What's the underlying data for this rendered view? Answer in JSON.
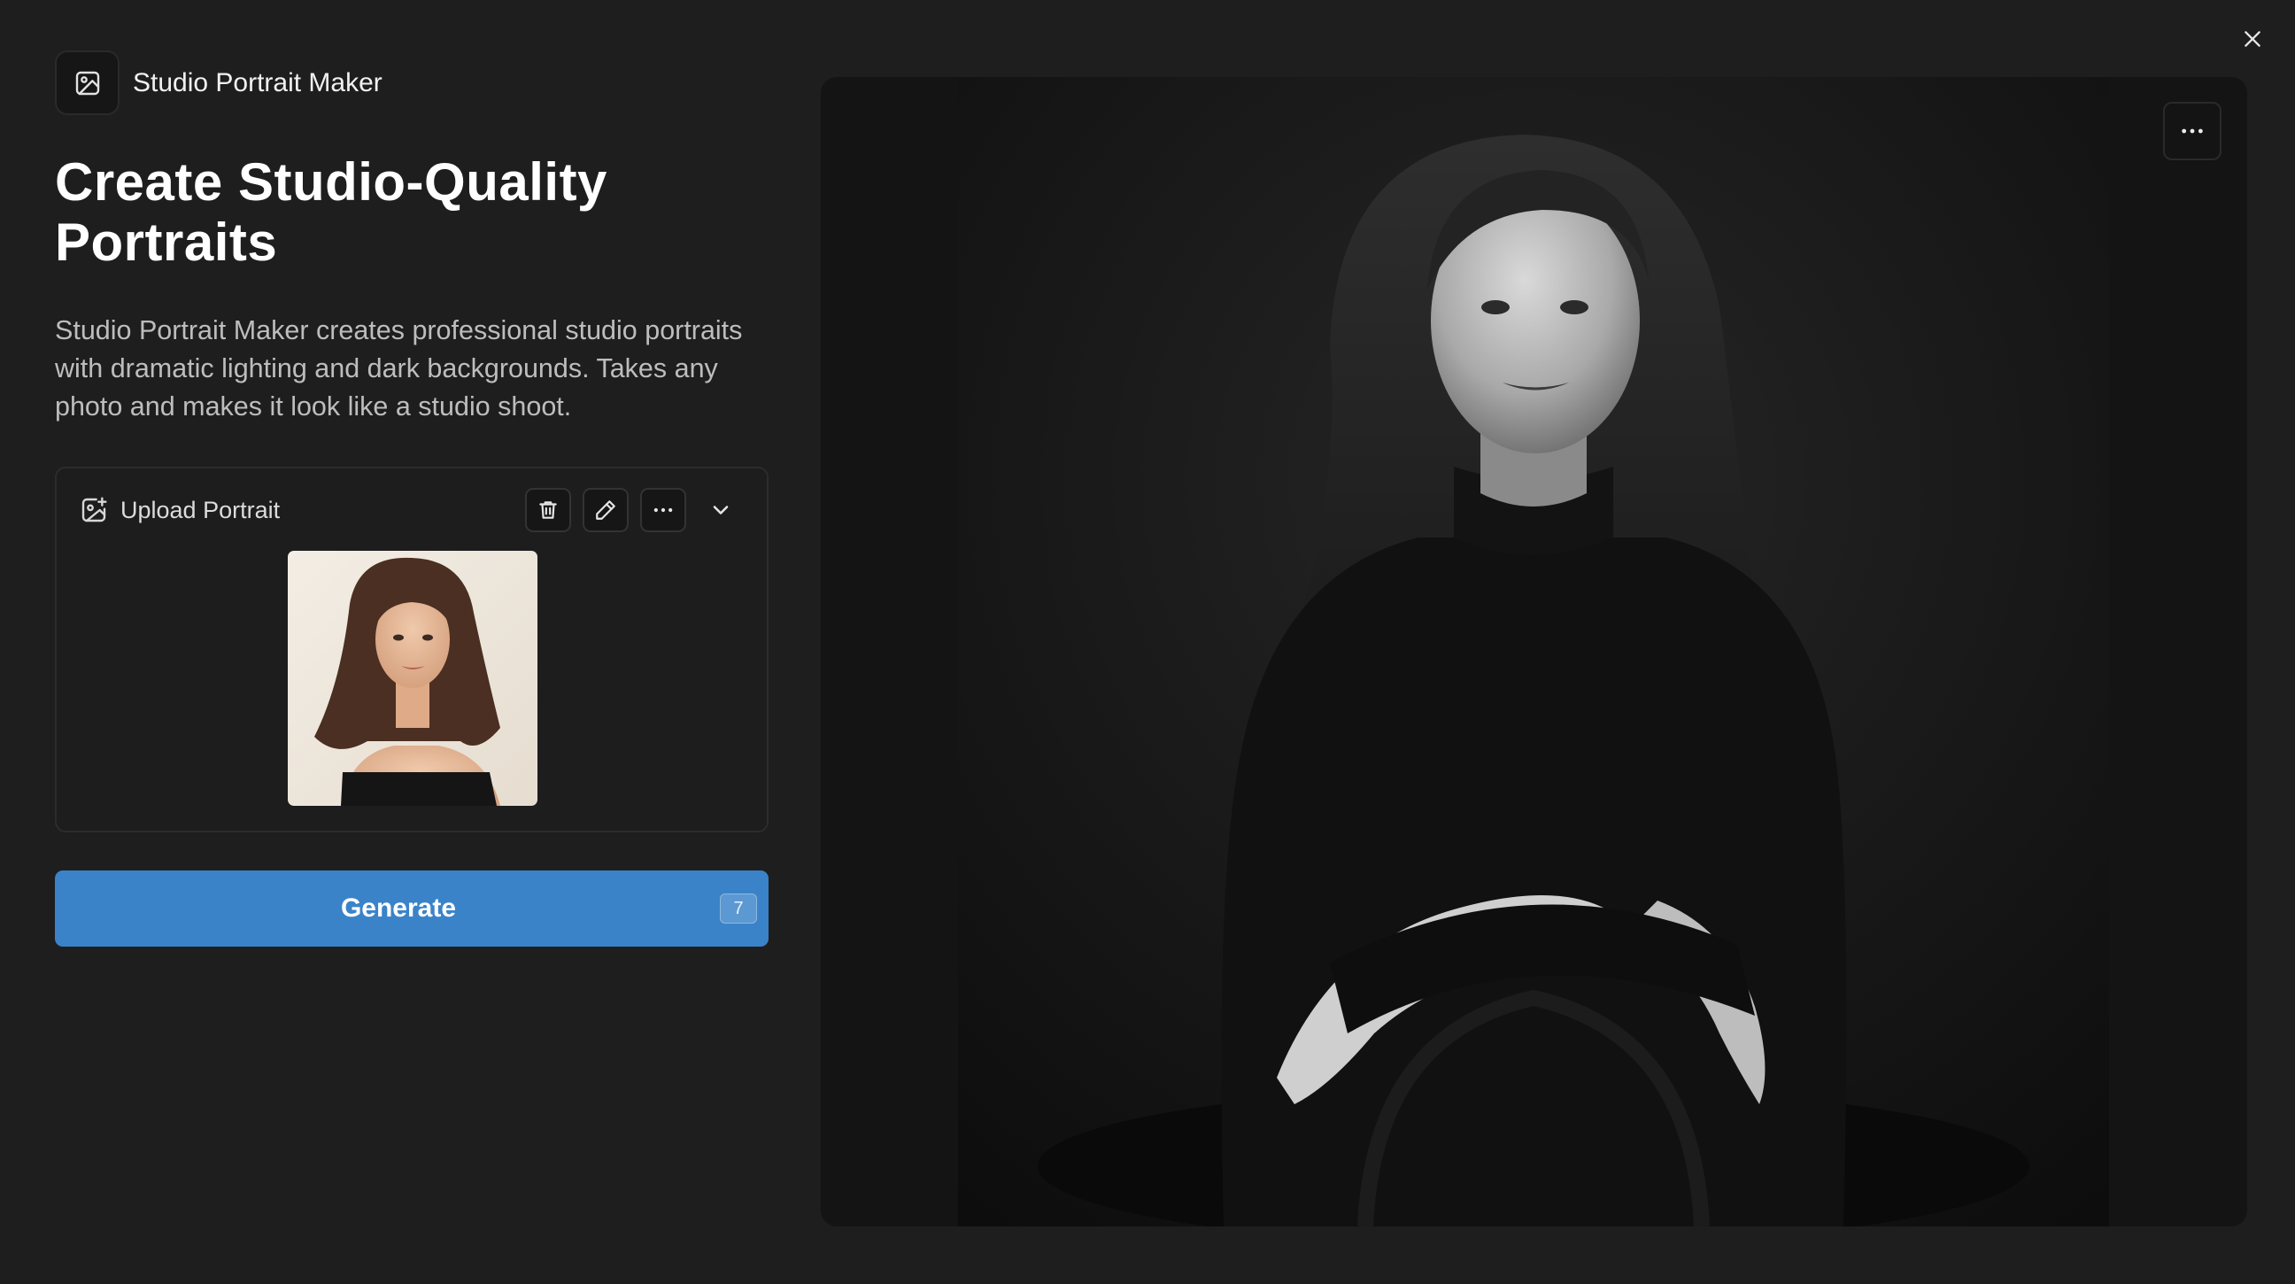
{
  "header": {
    "app_name": "Studio Portrait Maker",
    "app_icon": "image-icon",
    "close_icon": "close-icon"
  },
  "intro": {
    "title": "Create Studio-Quality Portraits",
    "description": "Studio Portrait Maker creates professional studio portraits with dramatic lighting and dark backgrounds. Takes any photo and makes it look like a studio shoot."
  },
  "upload": {
    "label": "Upload Portrait",
    "icon": "image-plus-icon",
    "actions": [
      "trash-icon",
      "pencil-icon",
      "more-horizontal-icon",
      "chevron-down-icon"
    ]
  },
  "generate": {
    "label": "Generate",
    "credits": "7"
  },
  "preview": {
    "menu_icon": "more-horizontal-icon"
  },
  "colors": {
    "background": "#1e1e1f",
    "accent": "#3a83c9",
    "panel": "#141415"
  }
}
